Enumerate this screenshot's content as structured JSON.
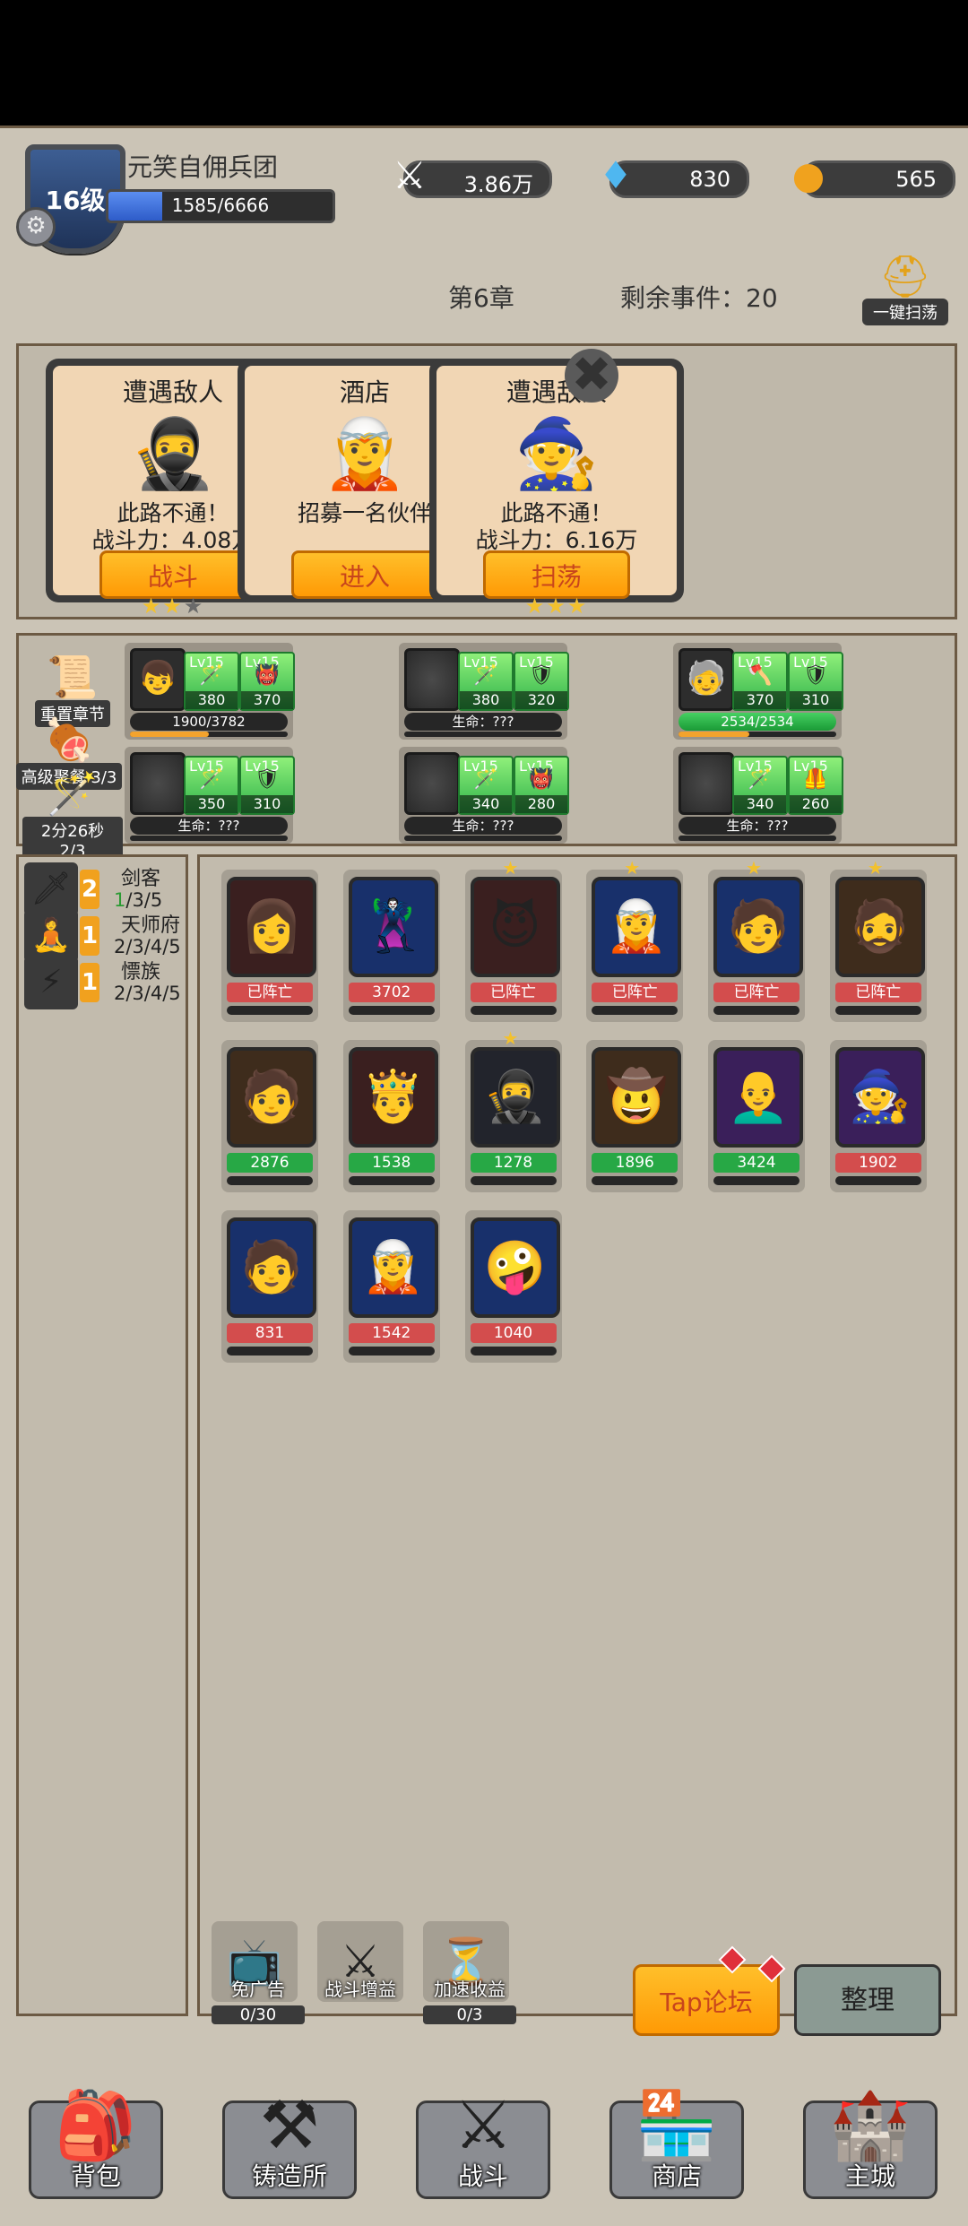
{
  "header": {
    "level": "16级",
    "guild_name": "元笑自佣兵团",
    "xp_text": "1585/6666",
    "xp_fraction": 0.238,
    "power": "3.86万",
    "gems": "830",
    "gold": "565"
  },
  "chapter": "第6章",
  "remaining_events": "剩余事件：20",
  "sweep_all_label": "一键扫荡",
  "event_cards": [
    {
      "title": "遭遇敌人",
      "desc1": "此路不通！",
      "desc2": "战斗力：4.08万",
      "button": "战斗",
      "stars_on": 2,
      "portrait": "🥷"
    },
    {
      "title": "酒店",
      "desc1": "",
      "desc2": "招募一名伙伴",
      "button": "进入",
      "stars_on": 0,
      "portrait": "🧝"
    },
    {
      "title": "遭遇敌人",
      "desc1": "此路不通！",
      "desc2": "战斗力：6.16万",
      "button": "扫荡",
      "stars_on": 3,
      "portrait": "🧙"
    }
  ],
  "team_actions": [
    {
      "label": "重置章节",
      "icon": "scroll-icon",
      "glyph": "📜"
    },
    {
      "label": "高级聚餐 3/3",
      "icon": "meat-icon",
      "glyph": "🍖"
    },
    {
      "label": "2分26秒 2/3",
      "icon": "staff-icon",
      "glyph": "🪄"
    }
  ],
  "team_slots": [
    {
      "hero": "👦",
      "items": [
        {
          "lv": "Lv15",
          "n": "380",
          "g": "🪄"
        },
        {
          "lv": "Lv15",
          "n": "370",
          "g": "👹"
        }
      ],
      "hp": "1900/3782",
      "hp_green": false,
      "xp": 0.5
    },
    {
      "hero": "",
      "items": [
        {
          "lv": "Lv15",
          "n": "380",
          "g": "🪄"
        },
        {
          "lv": "Lv15",
          "n": "320",
          "g": "🛡"
        }
      ],
      "hp": "生命：???",
      "hp_green": false,
      "xp": 0
    },
    {
      "hero": "🧓",
      "items": [
        {
          "lv": "Lv15",
          "n": "370",
          "g": "🪓"
        },
        {
          "lv": "Lv15",
          "n": "310",
          "g": "🛡"
        }
      ],
      "hp": "2534/2534",
      "hp_green": true,
      "xp": 0.45
    },
    {
      "hero": "",
      "items": [
        {
          "lv": "Lv15",
          "n": "350",
          "g": "🪄"
        },
        {
          "lv": "Lv15",
          "n": "310",
          "g": "🛡"
        }
      ],
      "hp": "生命：???",
      "hp_green": false,
      "xp": 0
    },
    {
      "hero": "",
      "items": [
        {
          "lv": "Lv15",
          "n": "340",
          "g": "🪄"
        },
        {
          "lv": "Lv15",
          "n": "280",
          "g": "👹"
        }
      ],
      "hp": "生命：???",
      "hp_green": false,
      "xp": 0
    },
    {
      "hero": "",
      "items": [
        {
          "lv": "Lv15",
          "n": "340",
          "g": "🪄"
        },
        {
          "lv": "Lv15",
          "n": "260",
          "g": "🦺"
        }
      ],
      "hp": "生命：???",
      "hp_green": false,
      "xp": 0
    }
  ],
  "traits": [
    {
      "count": "2",
      "name": "剑客",
      "prog_hl": "1",
      "prog_rest": "/3/5",
      "glyph": "🗡"
    },
    {
      "count": "1",
      "name": "天师府",
      "prog_hl": "",
      "prog_rest": "2/3/4/5",
      "glyph": "🧘"
    },
    {
      "count": "1",
      "name": "慓族",
      "prog_hl": "",
      "prog_rest": "2/3/4/5",
      "glyph": "⚡"
    }
  ],
  "roster": [
    {
      "face": "👩",
      "bg": "",
      "label": "已阵亡",
      "color": "red",
      "star": false
    },
    {
      "face": "🦹",
      "bg": "blue",
      "label": "3702",
      "color": "red",
      "star": false
    },
    {
      "face": "😈",
      "bg": "",
      "label": "已阵亡",
      "color": "red",
      "star": true
    },
    {
      "face": "🧝",
      "bg": "blue",
      "label": "已阵亡",
      "color": "red",
      "star": true
    },
    {
      "face": "🧑",
      "bg": "blue",
      "label": "已阵亡",
      "color": "red",
      "star": true
    },
    {
      "face": "🧔",
      "bg": "brown",
      "label": "已阵亡",
      "color": "red",
      "star": true
    },
    {
      "face": "🧑",
      "bg": "brown",
      "label": "2876",
      "color": "green",
      "star": false
    },
    {
      "face": "🤴",
      "bg": "",
      "label": "1538",
      "color": "green",
      "star": false
    },
    {
      "face": "🥷",
      "bg": "dark",
      "label": "1278",
      "color": "green",
      "star": true
    },
    {
      "face": "🤠",
      "bg": "brown",
      "label": "1896",
      "color": "green",
      "star": false
    },
    {
      "face": "👨‍🦲",
      "bg": "purple",
      "label": "3424",
      "color": "green",
      "star": false
    },
    {
      "face": "🧙",
      "bg": "purple",
      "label": "1902",
      "color": "red",
      "star": false
    },
    {
      "face": "🧑",
      "bg": "blue",
      "label": "831",
      "color": "red",
      "star": false
    },
    {
      "face": "🧝",
      "bg": "blue",
      "label": "1542",
      "color": "red",
      "star": false
    },
    {
      "face": "🤪",
      "bg": "blue",
      "label": "1040",
      "color": "red",
      "star": false
    }
  ],
  "mini_actions": [
    {
      "label": "免广告",
      "count": "0/30",
      "glyph": "📺"
    },
    {
      "label": "战斗增益",
      "count": "",
      "glyph": "⚔"
    },
    {
      "label": "加速收益",
      "count": "0/3",
      "glyph": "⏳"
    }
  ],
  "buttons": {
    "tap": "Tap论坛",
    "sort": "整理"
  },
  "nav": [
    {
      "label": "背包",
      "glyph": "🎒"
    },
    {
      "label": "铸造所",
      "glyph": "⚒"
    },
    {
      "label": "战斗",
      "glyph": "⚔"
    },
    {
      "label": "商店",
      "glyph": "🏪"
    },
    {
      "label": "主城",
      "glyph": "🏰"
    }
  ]
}
